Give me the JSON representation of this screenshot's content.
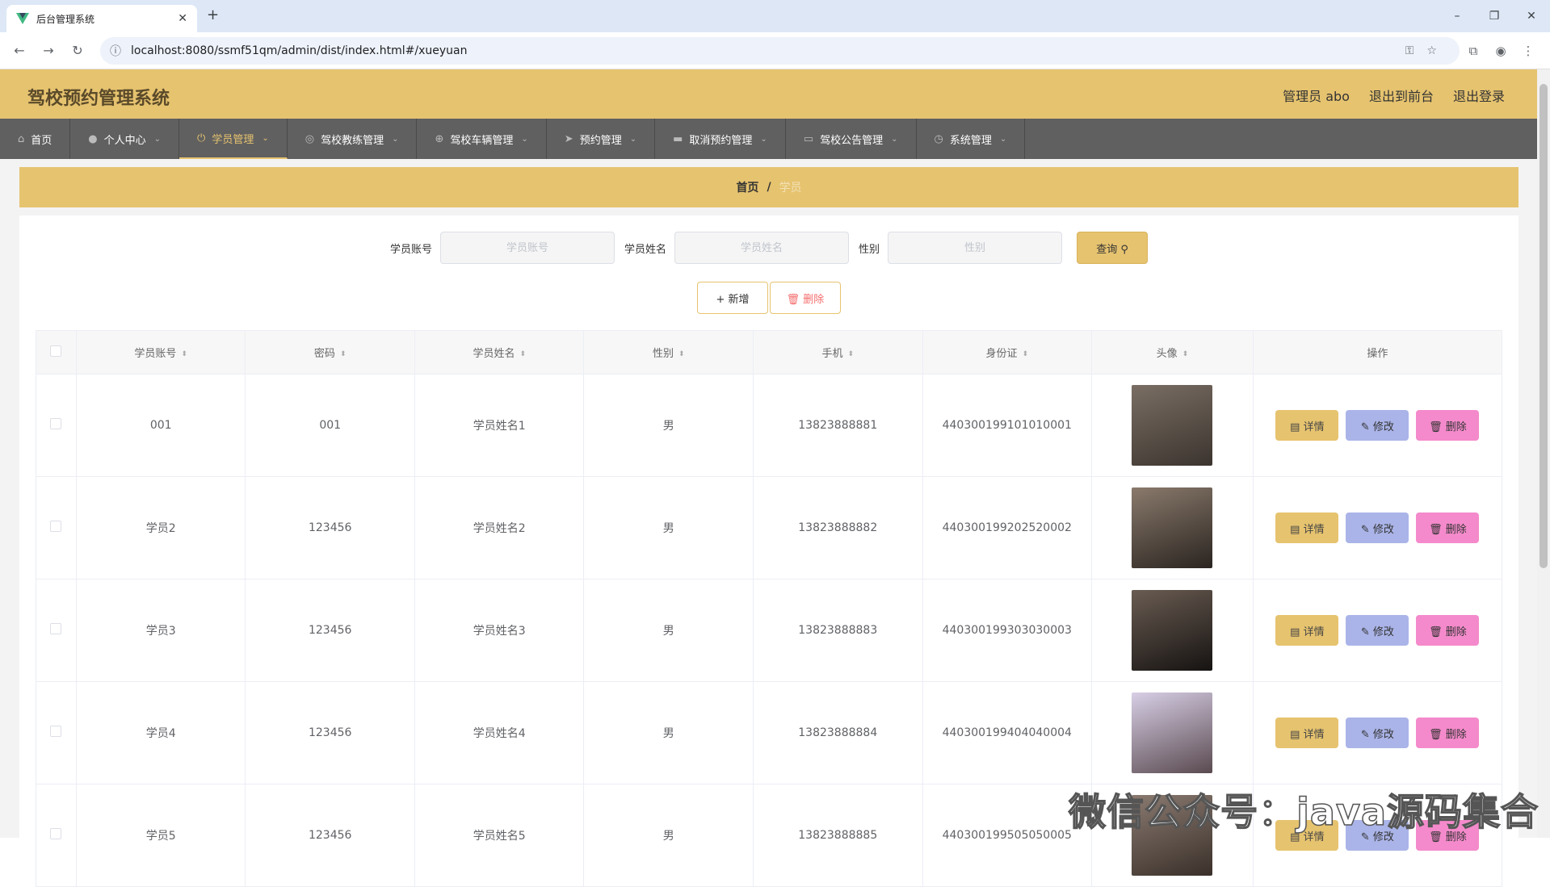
{
  "browser": {
    "tab_title": "后台管理系统",
    "new_tab": "+",
    "url": "localhost:8080/ssmf51qm/admin/dist/index.html#/xueyuan",
    "win_min": "–",
    "win_max": "❐",
    "win_close": "✕",
    "back": "←",
    "forward": "→",
    "reload": "↻"
  },
  "app": {
    "title": "驾校预约管理系统",
    "user": "管理员 abo",
    "to_front": "退出到前台",
    "logout": "退出登录"
  },
  "menu": [
    {
      "label": "首页",
      "icon": "⌂"
    },
    {
      "label": "个人中心",
      "icon": "●",
      "dropdown": "⌄"
    },
    {
      "label": "学员管理",
      "icon": "⏻",
      "dropdown": "⌄"
    },
    {
      "label": "驾校教练管理",
      "icon": "◎",
      "dropdown": "⌄"
    },
    {
      "label": "驾校车辆管理",
      "icon": "⊕",
      "dropdown": "⌄"
    },
    {
      "label": "预约管理",
      "icon": "➤",
      "dropdown": "⌄"
    },
    {
      "label": "取消预约管理",
      "icon": "▬",
      "dropdown": "⌄"
    },
    {
      "label": "驾校公告管理",
      "icon": "▭",
      "dropdown": "⌄"
    },
    {
      "label": "系统管理",
      "icon": "◷",
      "dropdown": "⌄"
    }
  ],
  "breadcrumb": {
    "home": "首页",
    "sep": "/",
    "current": "学员"
  },
  "search": {
    "account_label": "学员账号",
    "account_placeholder": "学员账号",
    "name_label": "学员姓名",
    "name_placeholder": "学员姓名",
    "gender_label": "性别",
    "gender_placeholder": "性别",
    "query": "查询 ⚲"
  },
  "actions": {
    "add": "+ 新增",
    "delete": "🗑 删除"
  },
  "table": {
    "headers": [
      "学员账号",
      "密码",
      "学员姓名",
      "性别",
      "手机",
      "身份证",
      "头像",
      "操作"
    ],
    "sort_icon": "⬍",
    "op_labels": {
      "detail": "▤ 详情",
      "edit": "✎ 修改",
      "delete": "🗑 删除"
    },
    "rows": [
      {
        "account": "001",
        "password": "001",
        "name": "学员姓名1",
        "gender": "男",
        "phone": "13823888881",
        "idcard": "440300199101010001",
        "avatar_color": "#5b5147"
      },
      {
        "account": "学员2",
        "password": "123456",
        "name": "学员姓名2",
        "gender": "男",
        "phone": "13823888882",
        "idcard": "440300199202520002",
        "avatar_color": "#4a4038"
      },
      {
        "account": "学员3",
        "password": "123456",
        "name": "学员姓名3",
        "gender": "男",
        "phone": "13823888883",
        "idcard": "440300199303030003",
        "avatar_color": "#2e2a28"
      },
      {
        "account": "学员4",
        "password": "123456",
        "name": "学员姓名4",
        "gender": "男",
        "phone": "13823888884",
        "idcard": "440300199404040004",
        "avatar_color": "#b7a6c9"
      },
      {
        "account": "学员5",
        "password": "123456",
        "name": "学员姓名5",
        "gender": "男",
        "phone": "13823888885",
        "idcard": "440300199505050005",
        "avatar_color": "#6a5a50"
      }
    ]
  },
  "watermark": "微信公众号：java源码集合"
}
